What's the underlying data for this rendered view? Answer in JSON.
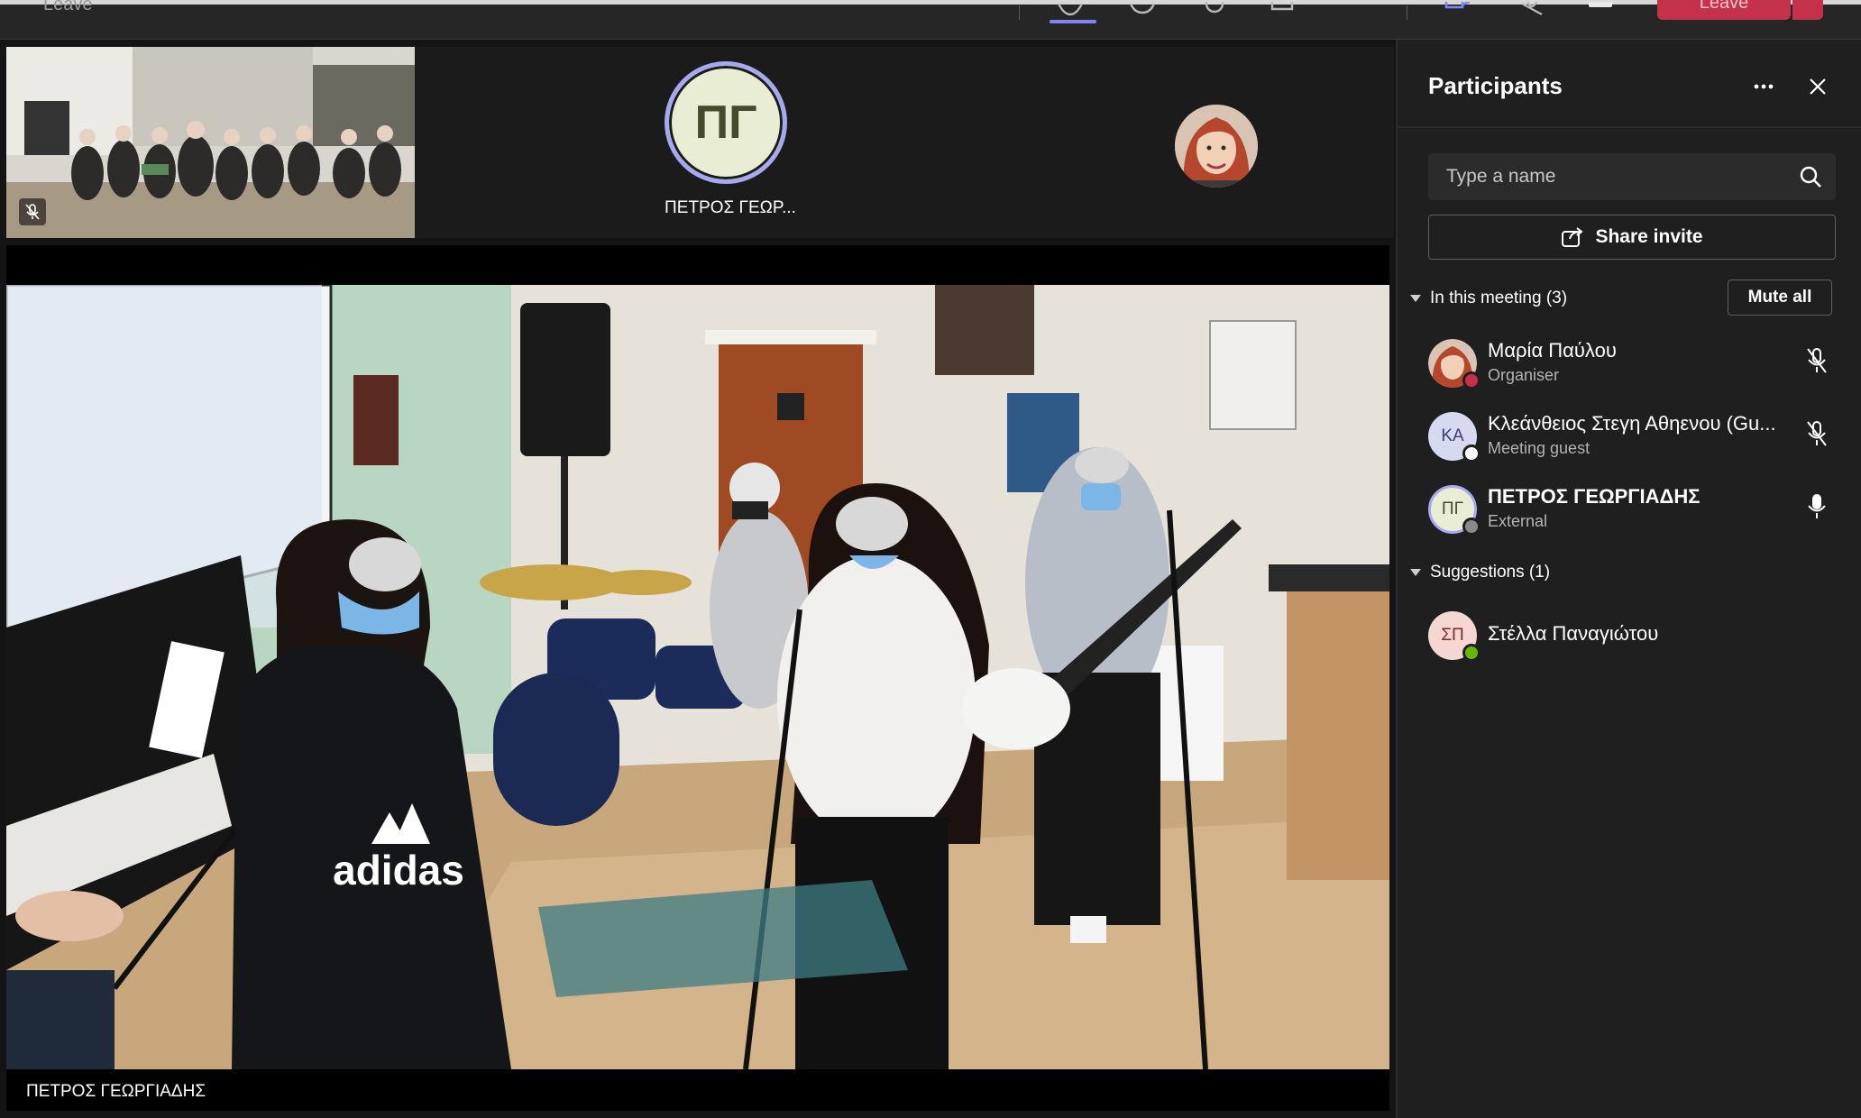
{
  "toolbar": {
    "ghost_left": "Leave",
    "ghost_center": "",
    "leave_label": "Leave"
  },
  "tiles": {
    "petros": {
      "initials": "ΠΓ",
      "name": "ΠΕΤΡΟΣ ΓΕΩΡ..."
    },
    "main_video_label": "ΠΕΤΡΟΣ ΓΕΩΡΓΙΑΔΗΣ",
    "main_video_shirt_text": "adidas"
  },
  "panel": {
    "title": "Participants",
    "search": {
      "placeholder": "Type a name",
      "value": ""
    },
    "share_label": "Share invite",
    "in_meeting_label": "In this meeting (3)",
    "mute_all_label": "Mute all",
    "suggestions_label": "Suggestions (1)",
    "in_meeting": [
      {
        "name": "Μαρία Παύλου",
        "role": "Organiser",
        "initials": "",
        "mic": "muted",
        "status": "busy"
      },
      {
        "name": "Κλεάνθειος Στεγη Αθηενου (Gu...",
        "role": "Meeting guest",
        "initials": "ΚΑ",
        "mic": "muted",
        "status": "unknown"
      },
      {
        "name": "ΠΕΤΡΟΣ ΓΕΩΡΓΙΑΔΗΣ",
        "role": "External",
        "initials": "ΠΓ",
        "mic": "on",
        "status": "offline"
      }
    ],
    "suggestions": [
      {
        "name": "Στέλλα Παναγιώτου",
        "initials": "ΣΠ",
        "status": "available"
      }
    ]
  },
  "colors": {
    "accent": "#7f85f5",
    "leave": "#c4314b",
    "busy": "#c4314b",
    "available": "#6bb700"
  }
}
